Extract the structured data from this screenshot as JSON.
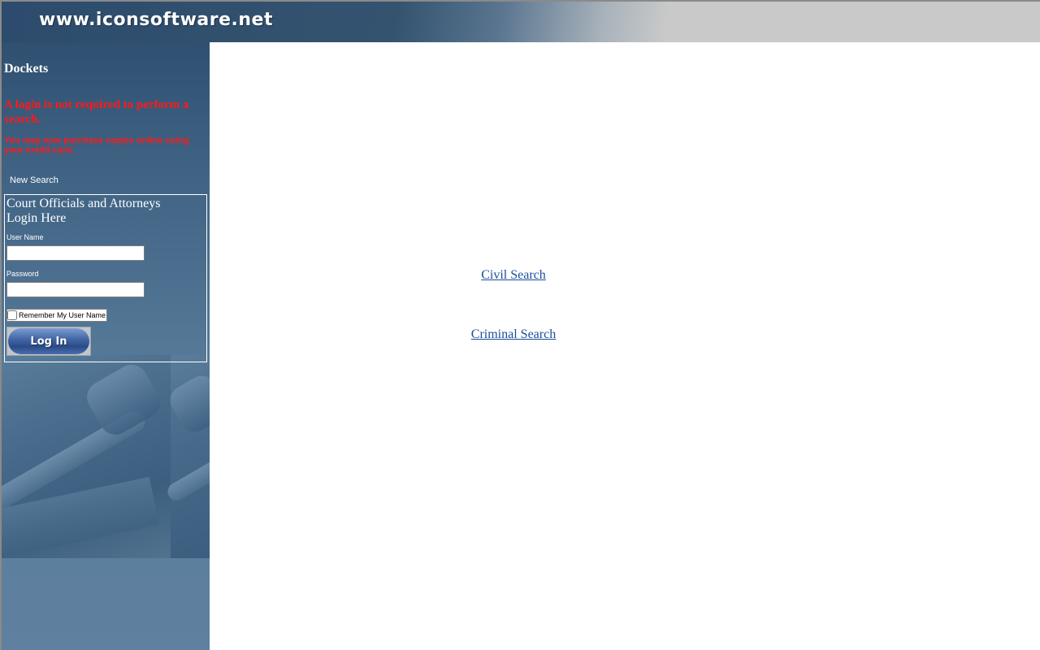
{
  "header": {
    "site_title": "www.iconsoftware.net"
  },
  "sidebar": {
    "title": "Dockets",
    "notice_main": "A login is not required to perform a search.",
    "notice_sub": "You may now purchase copies online using your credit card.",
    "new_search_label": "New Search",
    "login": {
      "heading_line1": "Court Officials and Attorneys",
      "heading_line2": "Login Here",
      "username_label": "User Name",
      "username_value": "",
      "password_label": "Password",
      "password_value": "",
      "remember_label": "Remember My User Name",
      "remember_checked": false,
      "login_button_label": "Log In"
    }
  },
  "main": {
    "links": [
      {
        "label": "Civil Search"
      },
      {
        "label": "Criminal Search"
      }
    ]
  },
  "colors": {
    "banner_dark": "#2d4c6d",
    "banner_light": "#c9c9c9",
    "sidebar_blue": "#4f7190",
    "notice_red": "#ff1a1a",
    "link_blue": "#1a4d9c"
  }
}
